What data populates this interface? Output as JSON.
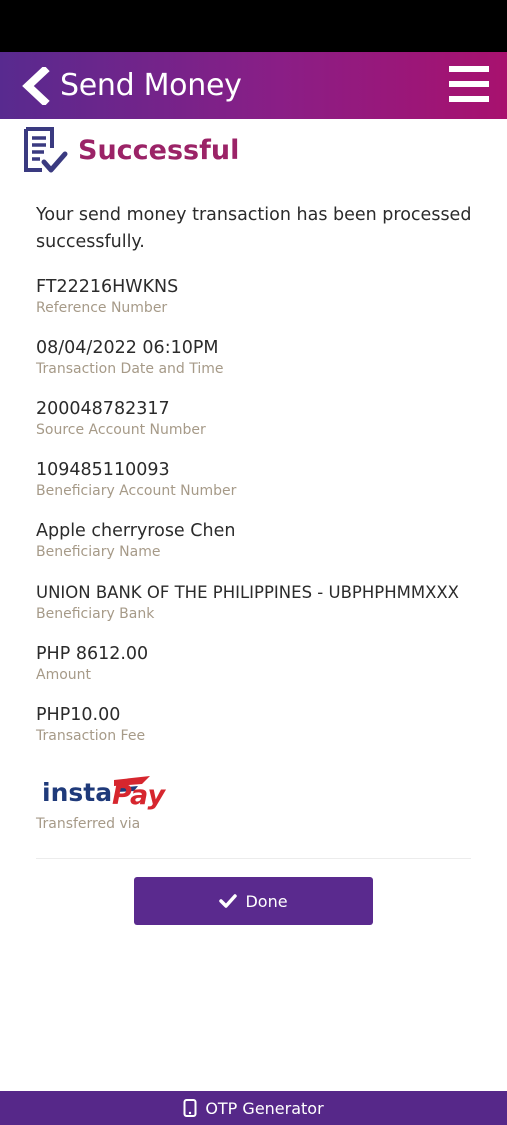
{
  "header": {
    "title": "Send Money"
  },
  "status": {
    "title": "Successful",
    "message": "Your send money transaction has been processed successfully."
  },
  "fields": [
    {
      "value": "FT22216HWKNS",
      "label": "Reference Number"
    },
    {
      "value": "08/04/2022 06:10PM",
      "label": "Transaction Date and Time"
    },
    {
      "value": "200048782317",
      "label": "Source Account Number"
    },
    {
      "value": "109485110093",
      "label": "Beneficiary Account Number"
    },
    {
      "value": "Apple cherryrose Chen",
      "label": "Beneficiary Name"
    },
    {
      "value": "UNION BANK OF THE PHILIPPINES - UBPHPHMMXXX",
      "label": "Beneficiary Bank"
    },
    {
      "value": "PHP 8612.00",
      "label": "Amount"
    },
    {
      "value": "PHP10.00",
      "label": "Transaction Fee"
    }
  ],
  "transfer": {
    "logo_text_left": "insta",
    "logo_text_right": "Pay",
    "label": "Transferred via"
  },
  "actions": {
    "done_label": "Done"
  },
  "footer": {
    "otp_label": "OTP Generator"
  },
  "colors": {
    "brand_purple": "#5a2a8e",
    "brand_magenta": "#a8116e",
    "success_title": "#9b2367",
    "label_gray": "#a69a88"
  },
  "icons": [
    "back-arrow-icon",
    "menu-icon",
    "document-check-icon",
    "check-icon",
    "phone-icon"
  ]
}
